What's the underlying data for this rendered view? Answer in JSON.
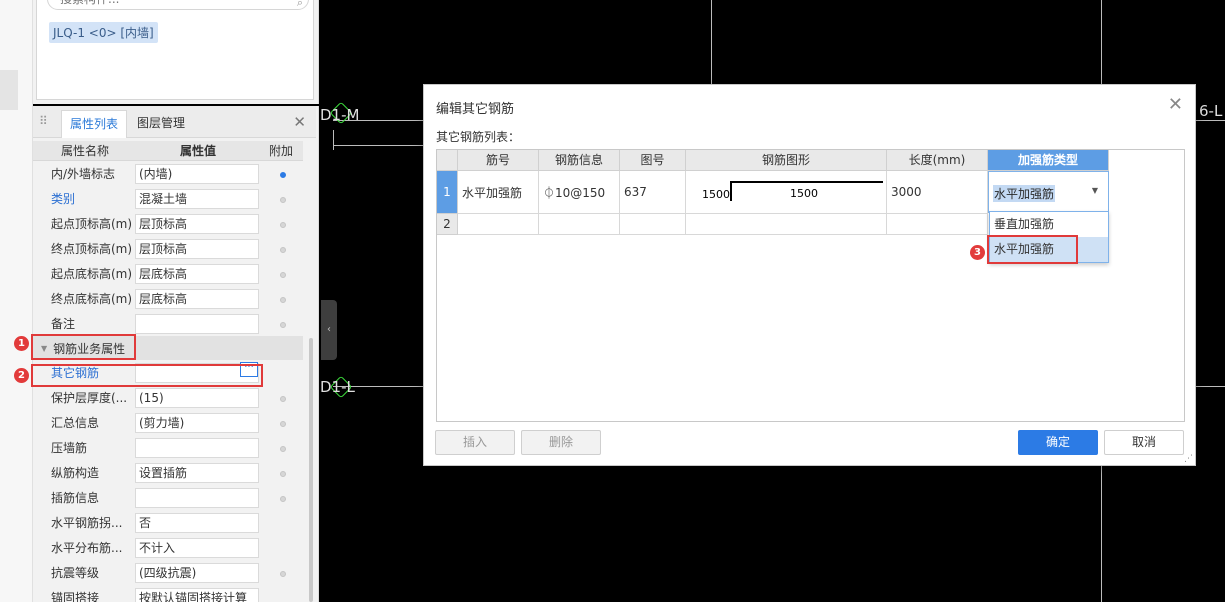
{
  "search": {
    "placeholder": "搜索构件..."
  },
  "element_tag": "JLQ-1 <0> [内墙]",
  "tabs": {
    "properties": "属性列表",
    "layers": "图层管理"
  },
  "prop_headers": {
    "name": "属性名称",
    "value": "属性值",
    "attach": "附加"
  },
  "properties": [
    {
      "name": "内/外墙标志",
      "value": "(内墙)",
      "attach": "on"
    },
    {
      "name": "类别",
      "value": "混凝土墙",
      "attach": "off",
      "blue": true
    },
    {
      "name": "起点顶标高(m)",
      "value": "层顶标高",
      "attach": "off"
    },
    {
      "name": "终点顶标高(m)",
      "value": "层顶标高",
      "attach": "off"
    },
    {
      "name": "起点底标高(m)",
      "value": "层底标高",
      "attach": "off"
    },
    {
      "name": "终点底标高(m)",
      "value": "层底标高",
      "attach": "off"
    },
    {
      "name": "备注",
      "value": "",
      "attach": "off"
    }
  ],
  "section_label": "钢筋业务属性",
  "other_rebar_label": "其它钢筋",
  "properties2": [
    {
      "name": "保护层厚度(...",
      "value": "(15)",
      "attach": "off"
    },
    {
      "name": "汇总信息",
      "value": "(剪力墙)",
      "attach": "off"
    },
    {
      "name": "压墙筋",
      "value": "",
      "attach": "off"
    },
    {
      "name": "纵筋构造",
      "value": "设置插筋",
      "attach": "off"
    },
    {
      "name": "插筋信息",
      "value": "",
      "attach": "off"
    },
    {
      "name": "水平钢筋拐...",
      "value": "否",
      "attach": "none"
    },
    {
      "name": "水平分布筋...",
      "value": "不计入",
      "attach": "none"
    },
    {
      "name": "抗震等级",
      "value": "(四级抗震)",
      "attach": "off"
    },
    {
      "name": "锚固搭接",
      "value": "按默认锚固搭接计算",
      "attach": "none"
    }
  ],
  "annotations": [
    "1",
    "2",
    "3"
  ],
  "canvas": {
    "label_d1m": "D1-M",
    "label_d1l": "D1-L",
    "label_right": "6-L"
  },
  "dialog": {
    "title": "编辑其它钢筋",
    "subtitle": "其它钢筋列表：",
    "columns": [
      "筋号",
      "钢筋信息",
      "图号",
      "钢筋图形",
      "长度(mm)",
      "加强筋类型"
    ],
    "rows": [
      {
        "num": "1",
        "name": "水平加强筋",
        "info": "⏀10@150",
        "fig": "637",
        "shape_left": "1500",
        "shape_mid": "1500",
        "length": "3000",
        "type": "水平加强筋"
      },
      {
        "num": "2",
        "name": "",
        "info": "",
        "fig": "",
        "length": "",
        "type": ""
      }
    ],
    "dropdown_options": [
      "垂直加强筋",
      "水平加强筋"
    ],
    "insert_label": "插入",
    "delete_label": "删除",
    "ok_label": "确定",
    "cancel_label": "取消"
  },
  "colors": {
    "accent": "#2c7be5",
    "highlight": "#e03a3a",
    "header_active": "#5d9de4"
  }
}
